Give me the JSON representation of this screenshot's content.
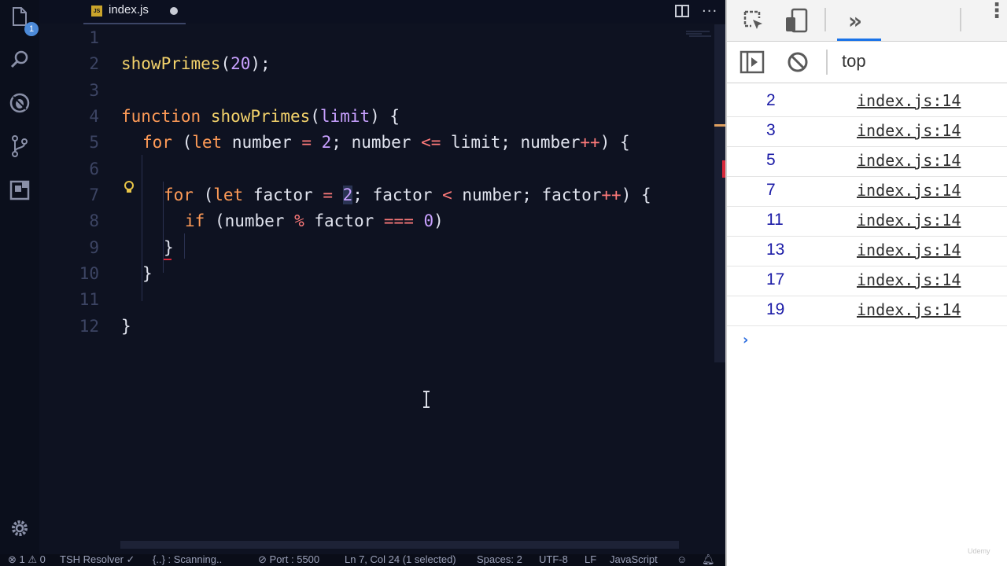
{
  "activity_bar": {
    "files_badge": "1",
    "icons": [
      "files-icon",
      "search-icon",
      "debug-icon",
      "source-control-icon",
      "extensions-icon",
      "settings-gear-icon"
    ]
  },
  "tab": {
    "label": "index.js",
    "type_badge": "JS"
  },
  "editor": {
    "line_numbers": [
      "1",
      "2",
      "3",
      "4",
      "5",
      "6",
      "7",
      "8",
      "9",
      "10",
      "11",
      "12"
    ],
    "lines": {
      "l2": {
        "fn": "showPrimes",
        "open": "(",
        "num": "20",
        "close": ");"
      },
      "l4": {
        "kw": "function",
        "fn": "showPrimes",
        "open": "(",
        "param": "limit",
        "close": ") {"
      },
      "l5": {
        "kw_for": "for",
        "paren": " (",
        "kw_let": "let",
        "var1": " number ",
        "eq": "=",
        "sp": " ",
        "num": "2",
        "semi1": "; number ",
        "lte": "<=",
        "rest1": " limit; number",
        "inc": "++",
        "end": ") {"
      },
      "l7": {
        "kw_for": "for",
        "paren": " (",
        "kw_let": "let",
        "var1": " factor ",
        "eq": "=",
        "sp": " ",
        "num": "2",
        "semi1": "; factor ",
        "lt": "<",
        "rest1": " number; factor",
        "inc": "++",
        "end": ") {"
      },
      "l8": {
        "kw_if": "if",
        "open": " (number ",
        "mod": "%",
        "mid": " factor ",
        "seq": "===",
        "sp": " ",
        "num": "0",
        "close": ")"
      },
      "l9": "}",
      "l10": "}",
      "l12": "}"
    }
  },
  "statusbar": {
    "errors": "1",
    "warnings": "0",
    "tsh": "TSH Resolver",
    "scanning": "{..} : Scanning..",
    "port": "Port : 5500",
    "position": "Ln 7, Col 24 (1 selected)",
    "spaces": "Spaces: 2",
    "encoding": "UTF-8",
    "eol": "LF",
    "language": "JavaScript"
  },
  "devtools": {
    "context": "top",
    "console_rows": [
      {
        "value": "2",
        "source": "index.js:14"
      },
      {
        "value": "3",
        "source": "index.js:14"
      },
      {
        "value": "5",
        "source": "index.js:14"
      },
      {
        "value": "7",
        "source": "index.js:14"
      },
      {
        "value": "11",
        "source": "index.js:14"
      },
      {
        "value": "13",
        "source": "index.js:14"
      },
      {
        "value": "17",
        "source": "index.js:14"
      },
      {
        "value": "19",
        "source": "index.js:14"
      }
    ],
    "prompt": "›"
  },
  "watermark": "Udemy"
}
